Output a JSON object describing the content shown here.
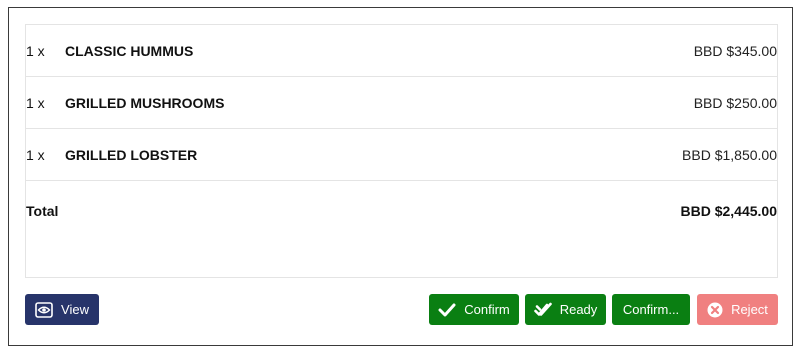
{
  "items": [
    {
      "qty": "1 x",
      "name": "CLASSIC HUMMUS",
      "price": "BBD $345.00"
    },
    {
      "qty": "1 x",
      "name": "GRILLED MUSHROOMS",
      "price": "BBD $250.00"
    },
    {
      "qty": "1 x",
      "name": "GRILLED LOBSTER",
      "price": "BBD $1,850.00"
    }
  ],
  "total": {
    "label": "Total",
    "value": "BBD $2,445.00"
  },
  "buttons": {
    "view": "View",
    "confirm": "Confirm",
    "ready": "Ready",
    "confirm_more": "Confirm...",
    "reject": "Reject"
  },
  "colors": {
    "view": "#27346a",
    "confirm": "#0a7f12",
    "reject": "#f08080"
  },
  "icons": {
    "view": "eye-icon",
    "confirm": "check-icon",
    "ready": "double-check-icon",
    "reject": "close-circle-icon"
  }
}
